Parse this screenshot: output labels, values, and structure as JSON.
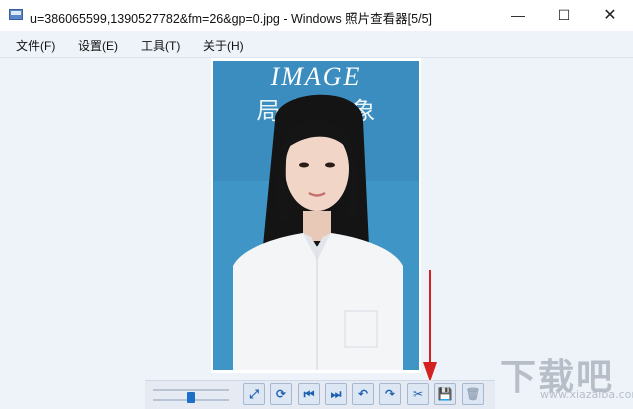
{
  "window": {
    "title": "u=386065599,1390527782&fm=26&gp=0.jpg - Windows 照片查看器[5/5]",
    "minimize_glyph": "—",
    "maximize_glyph": "☐",
    "close_glyph": "✕"
  },
  "menu": {
    "items": [
      {
        "label": "文件(F)"
      },
      {
        "label": "设置(E)"
      },
      {
        "label": "工具(T)"
      },
      {
        "label": "关于(H)"
      }
    ]
  },
  "photo": {
    "headline": "IMAGE",
    "subtitle": "局 部 印 象"
  },
  "toolbar": {
    "zoom_level": 0.5,
    "buttons": [
      {
        "name": "fit-window-icon",
        "glyph": "⤢"
      },
      {
        "name": "rotate-icon",
        "glyph": "⟳"
      },
      {
        "name": "first-image-icon",
        "glyph": "⏮"
      },
      {
        "name": "last-image-icon",
        "glyph": "⏭"
      },
      {
        "name": "rotate-left-icon",
        "glyph": "↶"
      },
      {
        "name": "rotate-right-icon",
        "glyph": "↷"
      },
      {
        "name": "crop-icon",
        "glyph": "✂"
      },
      {
        "name": "save-icon",
        "glyph": "💾"
      },
      {
        "name": "delete-icon",
        "glyph": "🗑"
      }
    ]
  },
  "watermark": {
    "text": "下载吧",
    "sub": "www.xiazaiba.com"
  },
  "colors": {
    "accent": "#1e6fc8",
    "arrow": "#d42020",
    "photo_bg": "#3d93c3"
  }
}
